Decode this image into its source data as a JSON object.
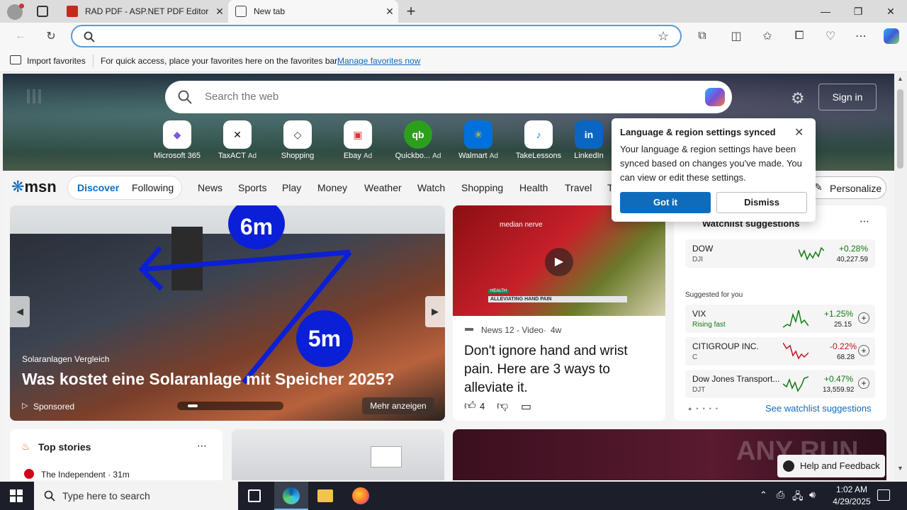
{
  "tabs": [
    {
      "title": "RAD PDF - ASP.NET PDF Editor ar",
      "active": false
    },
    {
      "title": "New tab",
      "active": true
    }
  ],
  "window": {
    "minimize": "—",
    "maximize": "❐",
    "close": "✕",
    "new_tab": "+"
  },
  "favorites_bar": {
    "import_label": "Import favorites",
    "hint": "For quick access, place your favorites here on the favorites bar.",
    "manage_link": "Manage favorites now"
  },
  "hero": {
    "search_placeholder": "Search the web",
    "sign_in": "Sign in",
    "quick_links": [
      {
        "label": "Microsoft 365",
        "ad": "",
        "glyph": "◆"
      },
      {
        "label": "TaxACT",
        "ad": "Ad",
        "glyph": "✕"
      },
      {
        "label": "Shopping",
        "ad": "",
        "glyph": "◇"
      },
      {
        "label": "Ebay",
        "ad": "Ad",
        "glyph": "▣"
      },
      {
        "label": "Quickbo...",
        "ad": "Ad",
        "glyph": "qb"
      },
      {
        "label": "Walmart",
        "ad": "Ad",
        "glyph": "✳"
      },
      {
        "label": "TakeLessons",
        "ad": "",
        "glyph": "♪"
      },
      {
        "label": "LinkedIn",
        "ad": "",
        "glyph": "in"
      }
    ]
  },
  "msn_nav": {
    "logo": "msn",
    "discover": "Discover",
    "following": "Following",
    "items": [
      "News",
      "Sports",
      "Play",
      "Money",
      "Weather",
      "Watch",
      "Shopping",
      "Health",
      "Travel",
      "T"
    ],
    "personalize": "Personalize"
  },
  "popup": {
    "title": "Language & region settings synced",
    "body": "Your language & region settings have been synced based on changes you've made. You can view or edit these settings.",
    "got_it": "Got it",
    "dismiss": "Dismiss"
  },
  "hero_card": {
    "badge_top": "6m",
    "badge_bottom": "5m",
    "source": "Solaranlagen Vergleich",
    "headline": "Was kostet eine Solaranlage mit Speicher 2025?",
    "sponsored": "Sponsored",
    "more": "Mehr anzeigen"
  },
  "video_card": {
    "overlay_top": "median nerve",
    "overlay_label1": "HEALTH",
    "overlay_label2": "ALLEVIATING HAND PAIN",
    "source": "News 12 - Video",
    "age": "4w",
    "headline": "Don't ignore hand and wrist pain. Here are 3 ways to alleviate it.",
    "likes": "4"
  },
  "watchlist": {
    "title": "Watchlist suggestions",
    "suggested_label": "Suggested for you",
    "see_more": "See watchlist suggestions",
    "top": {
      "name": "DOW",
      "symbol": "DJI",
      "change": "+0.28%",
      "price": "40,227.59"
    },
    "rows": [
      {
        "name": "VIX",
        "symbol": "Rising fast",
        "change": "+1.25%",
        "price": "25.15"
      },
      {
        "name": "CITIGROUP INC.",
        "symbol": "C",
        "change": "-0.22%",
        "price": "68.28"
      },
      {
        "name": "Dow Jones Transport...",
        "symbol": "DJT",
        "change": "+0.47%",
        "price": "13,559.92"
      }
    ]
  },
  "top_stories": {
    "title": "Top stories",
    "first_source": "The Independent · 31m"
  },
  "help": {
    "label": "Help and Feedback"
  },
  "taskbar": {
    "search_placeholder": "Type here to search",
    "time": "1:02 AM",
    "date": "4/29/2025"
  },
  "watermark": "ANY RUN",
  "colors": {
    "accent": "#0f6cbd",
    "positive": "#107c10",
    "negative": "#c50f1f"
  }
}
